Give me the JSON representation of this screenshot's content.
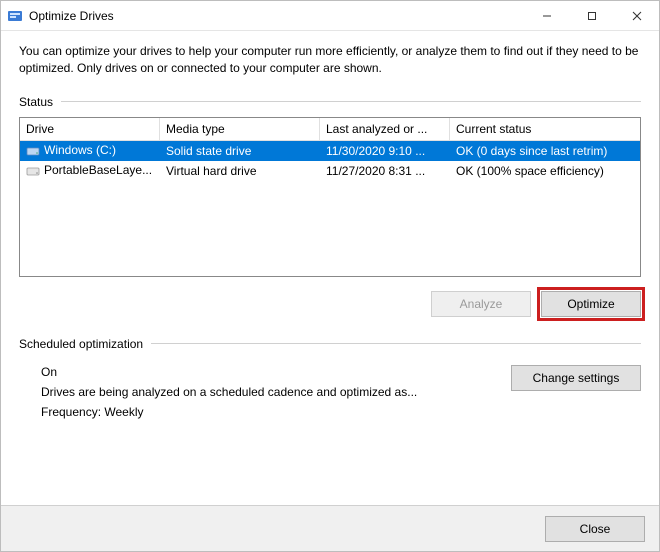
{
  "window": {
    "title": "Optimize Drives"
  },
  "description": "You can optimize your drives to help your computer run more efficiently, or analyze them to find out if they need to be optimized. Only drives on or connected to your computer are shown.",
  "status": {
    "label": "Status",
    "columns": {
      "drive": "Drive",
      "media": "Media type",
      "last": "Last analyzed or ...",
      "status": "Current status"
    },
    "rows": [
      {
        "drive": "Windows (C:)",
        "media": "Solid state drive",
        "last": "11/30/2020 9:10 ...",
        "status": "OK (0 days since last retrim)",
        "selected": true
      },
      {
        "drive": "PortableBaseLaye...",
        "media": "Virtual hard drive",
        "last": "11/27/2020 8:31 ...",
        "status": "OK (100% space efficiency)",
        "selected": false
      }
    ]
  },
  "buttons": {
    "analyze": "Analyze",
    "optimize": "Optimize",
    "change_settings": "Change settings",
    "close": "Close"
  },
  "scheduled": {
    "label": "Scheduled optimization",
    "state": "On",
    "detail": "Drives are being analyzed on a scheduled cadence and optimized as...",
    "frequency": "Frequency: Weekly"
  }
}
